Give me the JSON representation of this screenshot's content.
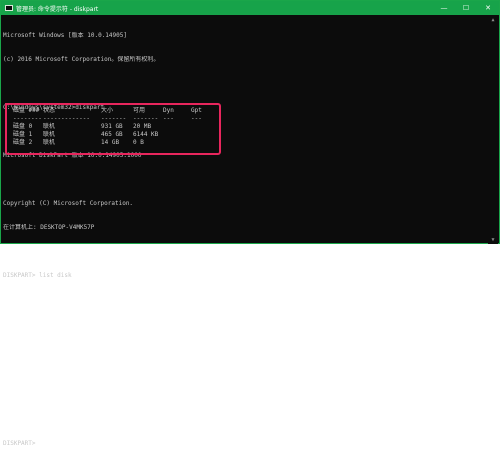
{
  "window": {
    "title": "管理员: 命令提示符 - diskpart",
    "minimize": "—",
    "maximize": "☐",
    "close": "✕",
    "accent_color": "#17a34a"
  },
  "console": {
    "lines": [
      "Microsoft Windows [版本 10.0.14905]",
      "(c) 2016 Microsoft Corporation。保留所有权利。",
      "",
      "C:\\Windows\\system32>diskpart",
      "",
      "Microsoft DiskPart 版本 10.0.14905.1000",
      "",
      "Copyright (C) Microsoft Corporation.",
      "在计算机上: DESKTOP-V4MK57P",
      "",
      "DISKPART> list disk",
      "",
      "",
      "",
      "",
      "",
      "",
      "DISKPART>"
    ]
  },
  "disk_table": {
    "headers": [
      "磁盘 ###",
      "状态",
      "大小",
      "可用",
      "Dyn",
      "Gpt"
    ],
    "separators": [
      "--------",
      "-------------",
      "-------",
      "-------",
      "---",
      "---"
    ],
    "rows": [
      [
        "磁盘 0",
        "联机",
        "931 GB",
        "20 MB",
        "",
        ""
      ],
      [
        "磁盘 1",
        "联机",
        "465 GB",
        "6144 KB",
        "",
        ""
      ],
      [
        "磁盘 2",
        "联机",
        "14 GB",
        "0 B",
        "",
        ""
      ]
    ]
  },
  "annotation_color": "#e8265d"
}
